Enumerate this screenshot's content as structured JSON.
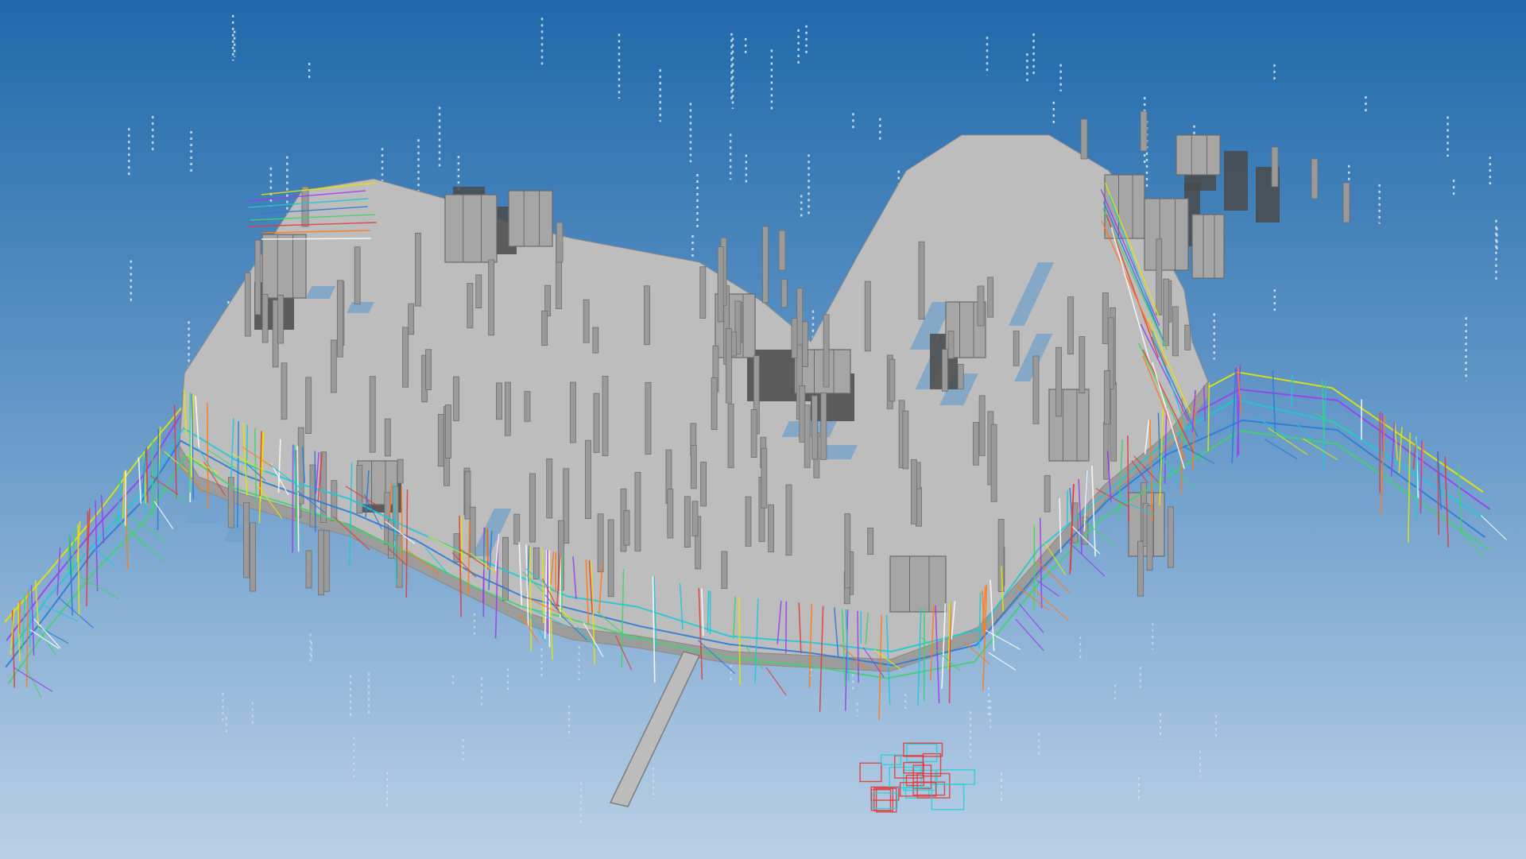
{
  "viewport": {
    "type": "3d-model-view",
    "render_mode": "shaded-with-wireframe",
    "background": {
      "top_color": "#1f69ab",
      "middle_color": "#6f9fcc",
      "bottom_color": "#bad0e6"
    },
    "model": {
      "slab_color": "#bdbdbd",
      "slab_edge_color": "#8a8a8a",
      "shadow_color": "#4a4a4a",
      "core_wall_color": "#5a5a5a",
      "column_color": "#9a9a9a",
      "marker_color": "#e9eef4",
      "wireframe_colors": [
        "#e6e600",
        "#9b3df0",
        "#1fc8d8",
        "#2a7bd6",
        "#3fd46b",
        "#e23b3b",
        "#ff7a1a",
        "#ffffff"
      ]
    }
  }
}
